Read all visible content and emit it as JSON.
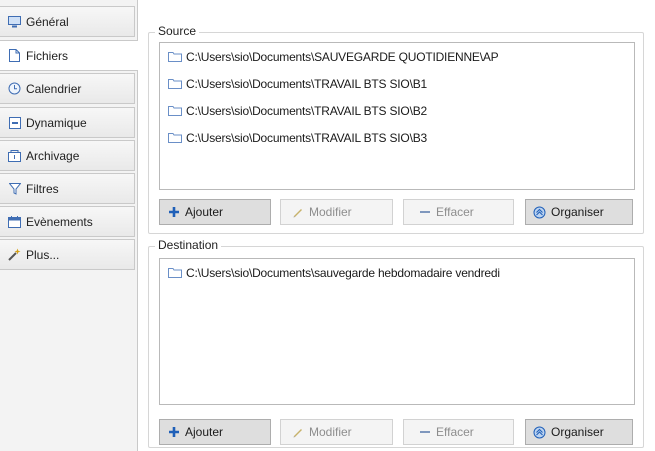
{
  "sidebar": {
    "tabs": [
      {
        "label": "Général",
        "icon": "monitor-icon"
      },
      {
        "label": "Fichiers",
        "icon": "file-icon"
      },
      {
        "label": "Calendrier",
        "icon": "clock-icon"
      },
      {
        "label": "Dynamique",
        "icon": "dynamic-icon"
      },
      {
        "label": "Archivage",
        "icon": "archive-icon"
      },
      {
        "label": "Filtres",
        "icon": "filter-icon"
      },
      {
        "label": "Evènements",
        "icon": "calendar-icon"
      },
      {
        "label": "Plus...",
        "icon": "wand-icon"
      }
    ],
    "selected": "Fichiers"
  },
  "source": {
    "title": "Source",
    "items": [
      "C:\\Users\\sio\\Documents\\SAUVEGARDE QUOTIDIENNE\\AP",
      "C:\\Users\\sio\\Documents\\TRAVAIL BTS SIO\\B1",
      "C:\\Users\\sio\\Documents\\TRAVAIL BTS SIO\\B2",
      "C:\\Users\\sio\\Documents\\TRAVAIL BTS SIO\\B3"
    ],
    "buttons": {
      "add": "Ajouter",
      "edit": "Modifier",
      "clear": "Effacer",
      "organize": "Organiser"
    }
  },
  "destination": {
    "title": "Destination",
    "items": [
      "C:\\Users\\sio\\Documents\\sauvegarde hebdomadaire vendredi"
    ],
    "buttons": {
      "add": "Ajouter",
      "edit": "Modifier",
      "clear": "Effacer",
      "organize": "Organiser"
    }
  },
  "colors": {
    "accent": "#1f5fb8",
    "folder": "#6a8fc7",
    "border": "#c9c9c9"
  }
}
